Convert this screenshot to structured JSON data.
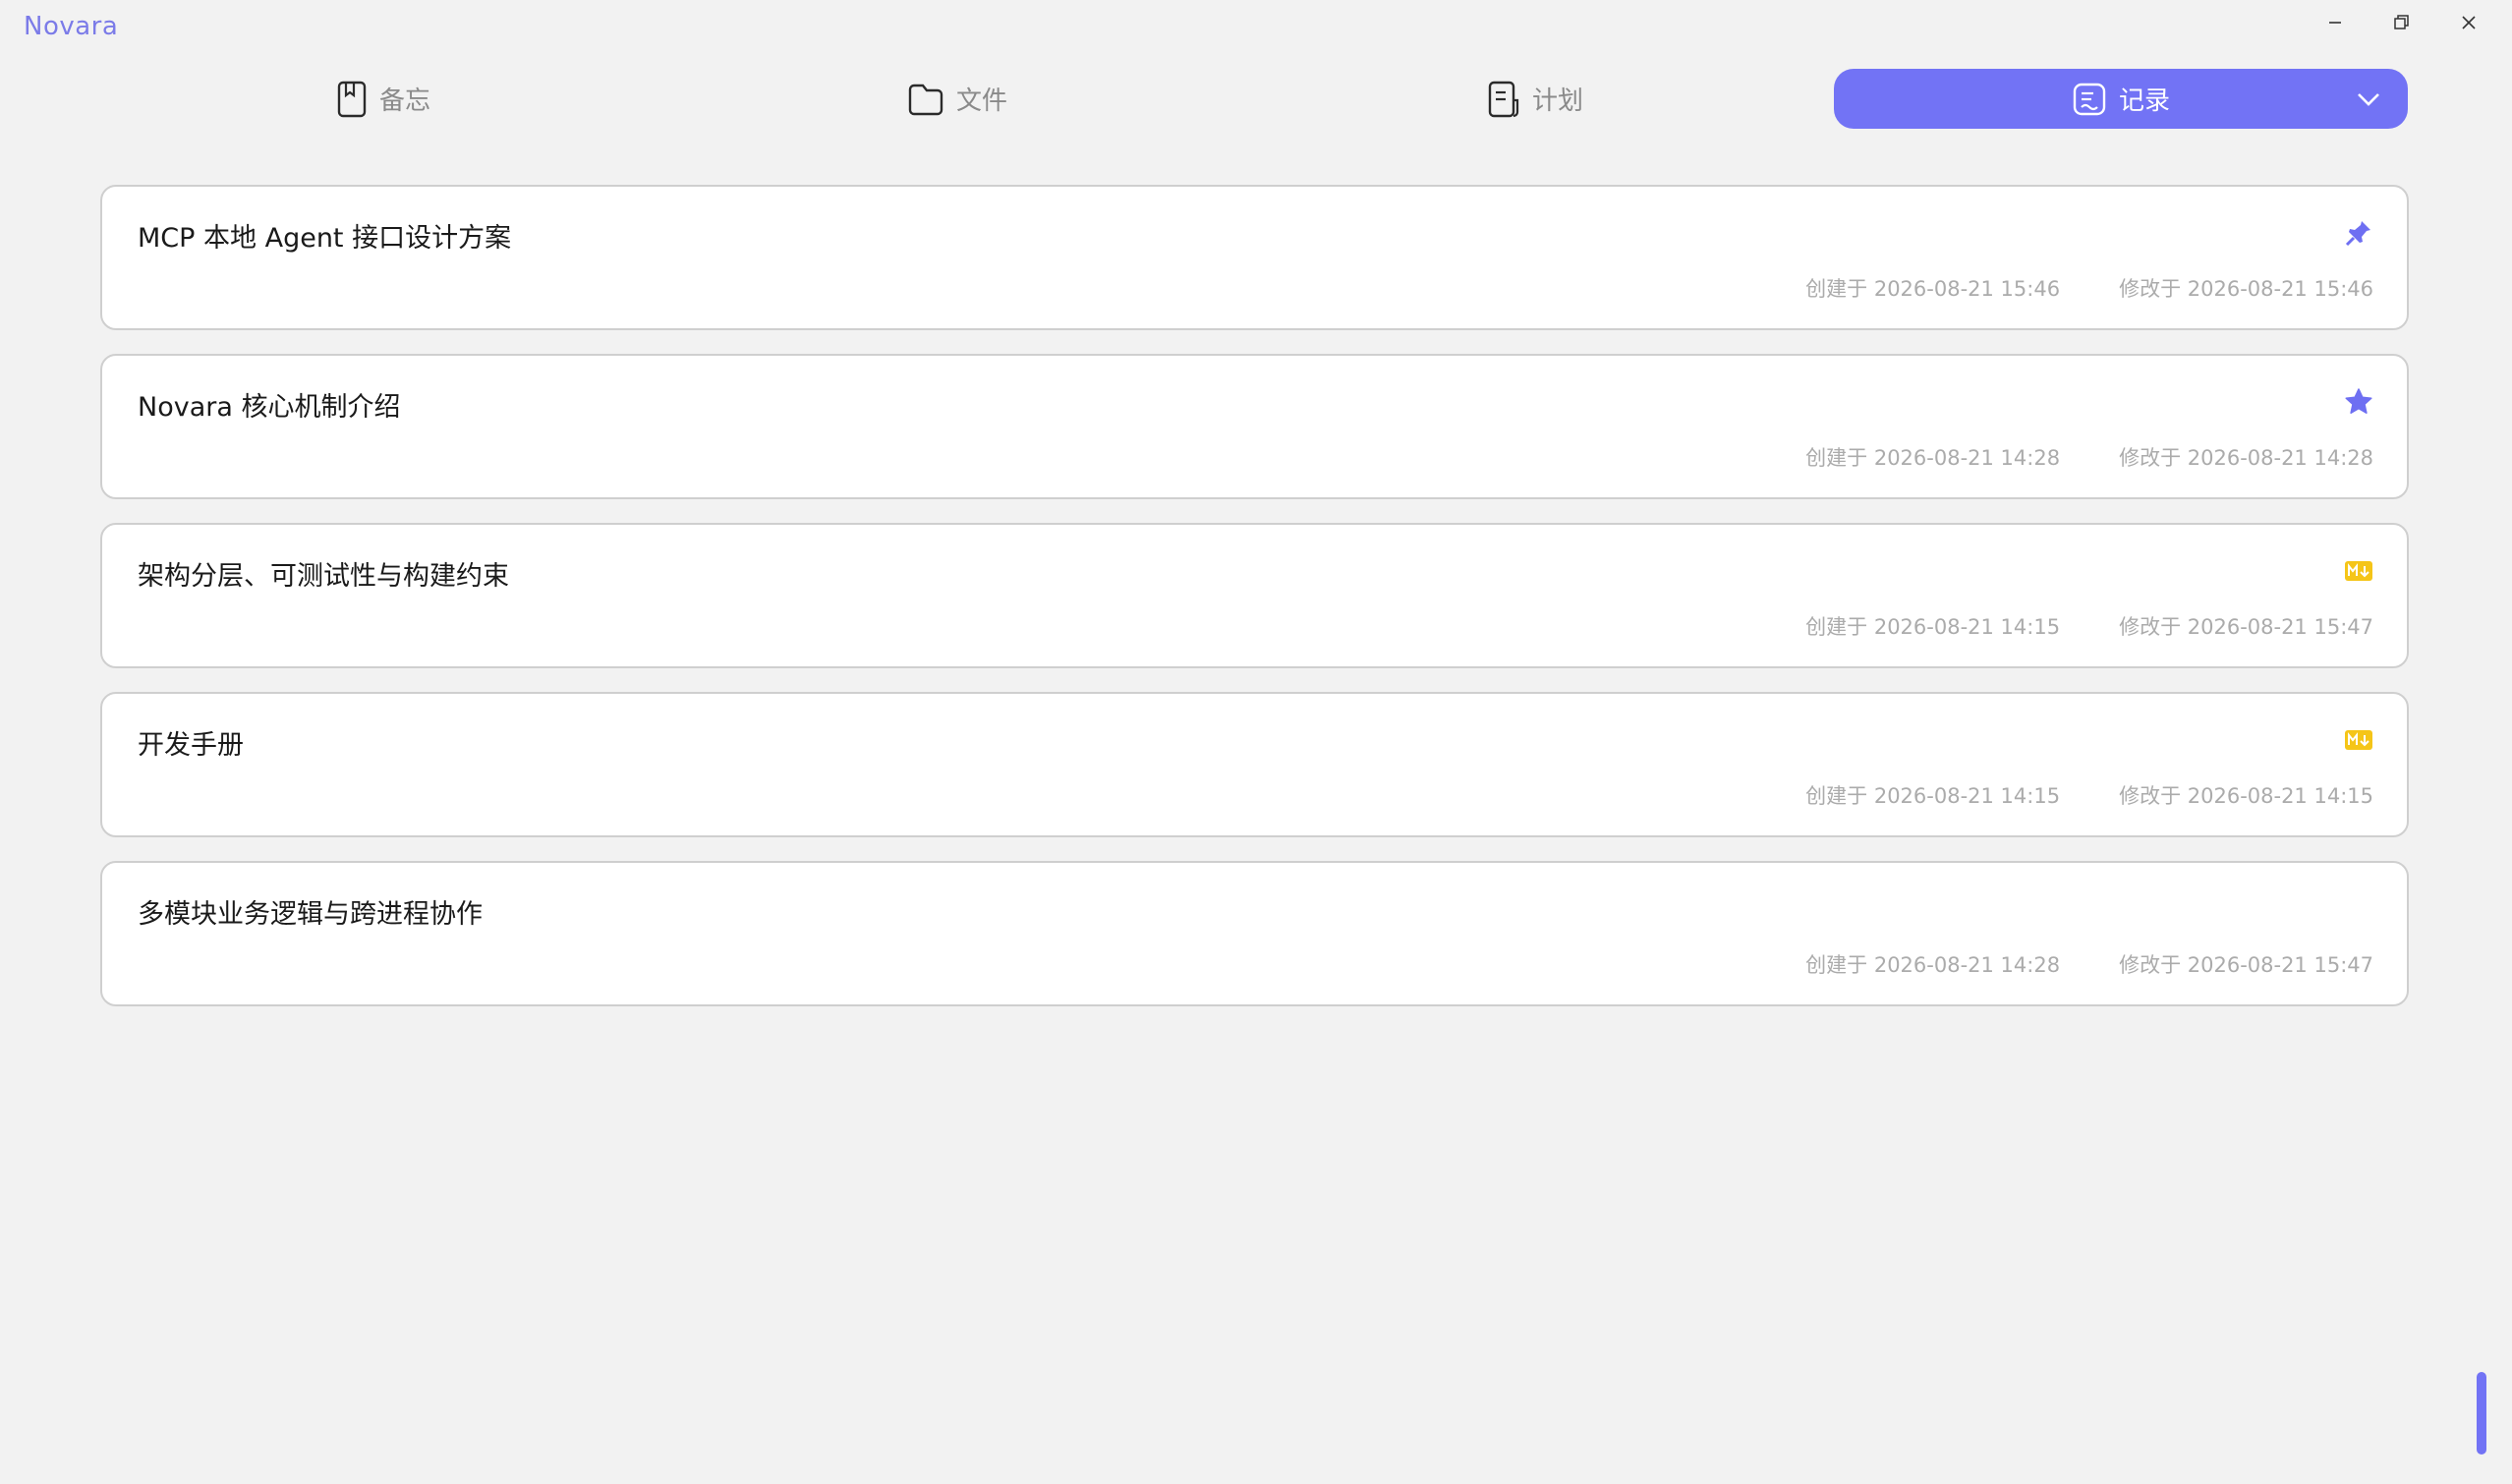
{
  "app": {
    "title": "Novara"
  },
  "tabs": [
    {
      "label": "备忘",
      "icon": "bookmark-icon",
      "active": false
    },
    {
      "label": "文件",
      "icon": "folder-icon",
      "active": false
    },
    {
      "label": "计划",
      "icon": "document-icon",
      "active": false
    },
    {
      "label": "记录",
      "icon": "note-icon",
      "active": true
    }
  ],
  "records": [
    {
      "title": "MCP 本地 Agent 接口设计方案",
      "badge": "pin-icon",
      "created": "创建于 2026-08-21 15:46",
      "modified": "修改于 2026-08-21 15:46"
    },
    {
      "title": "Novara 核心机制介绍",
      "badge": "star-icon",
      "created": "创建于 2026-08-21 14:28",
      "modified": "修改于 2026-08-21 14:28"
    },
    {
      "title": "架构分层、可测试性与构建约束",
      "badge": "markdown-icon",
      "created": "创建于 2026-08-21 14:15",
      "modified": "修改于 2026-08-21 15:47"
    },
    {
      "title": "开发手册",
      "badge": "markdown-icon",
      "created": "创建于 2026-08-21 14:15",
      "modified": "修改于 2026-08-21 14:15"
    },
    {
      "title": "多模块业务逻辑与跨进程协作",
      "badge": "",
      "created": "创建于 2026-08-21 14:28",
      "modified": "修改于 2026-08-21 15:47"
    }
  ],
  "colors": {
    "accent": "#7273f5",
    "markdown_badge": "#f5c518",
    "background": "#f2f2f2"
  }
}
